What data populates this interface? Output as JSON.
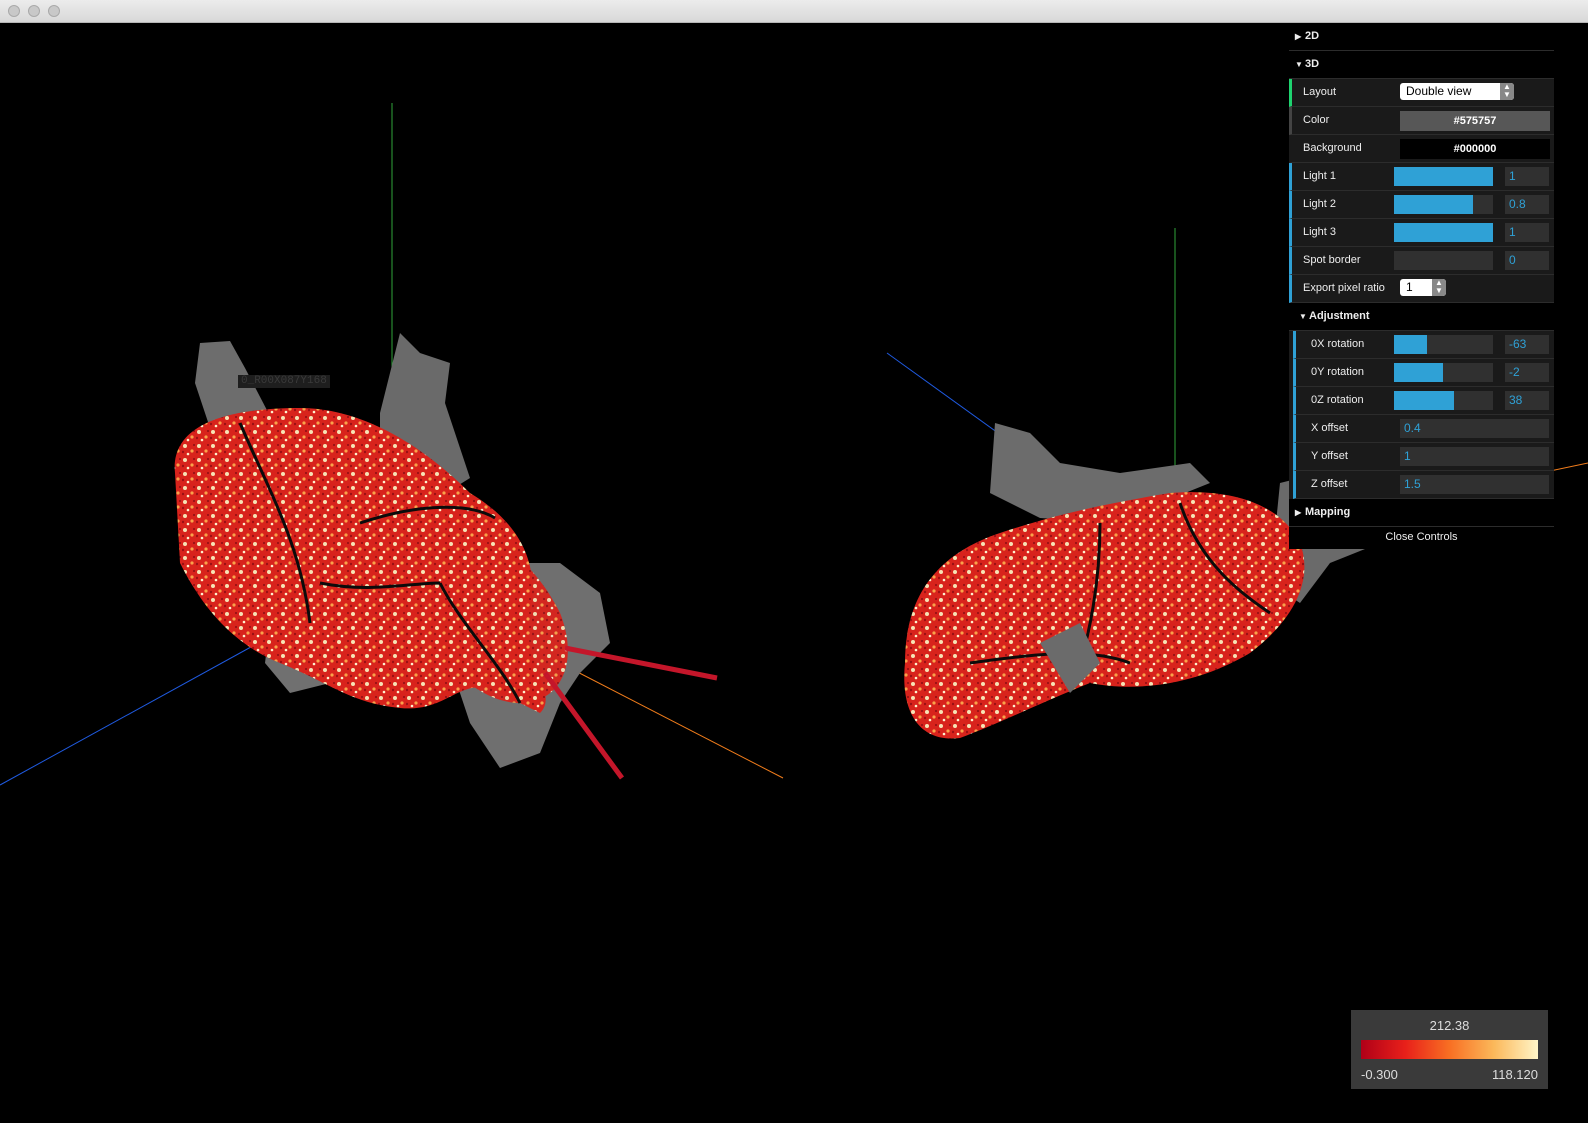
{
  "window": {
    "buttons": [
      "close",
      "minimize",
      "zoom"
    ]
  },
  "viewport": {
    "layout": "Double view",
    "mesh_label": "0_R00X087Y168",
    "axis_colors": {
      "x": "#f07c1b",
      "y": "#2fa33a",
      "z": "#1f5ae0"
    },
    "surface_color": "#575757"
  },
  "controls": {
    "folders": {
      "folder_2d": "2D",
      "folder_3d": "3D",
      "adjustment": "Adjustment",
      "mapping": "Mapping"
    },
    "layout": {
      "label": "Layout",
      "value": "Double view"
    },
    "color": {
      "label": "Color",
      "value": "#575757"
    },
    "background": {
      "label": "Background",
      "value": "#000000"
    },
    "light1": {
      "label": "Light 1",
      "value": "1",
      "fraction": 1.0
    },
    "light2": {
      "label": "Light 2",
      "value": "0.8",
      "fraction": 0.8
    },
    "light3": {
      "label": "Light 3",
      "value": "1",
      "fraction": 1.0
    },
    "spot_border": {
      "label": "Spot border",
      "value": "0",
      "fraction": 0
    },
    "export_pixel_ratio": {
      "label": "Export pixel ratio",
      "value": "1"
    },
    "rot_x": {
      "label": "0X rotation",
      "value": "-63",
      "fraction": 0.33
    },
    "rot_y": {
      "label": "0Y rotation",
      "value": "-2",
      "fraction": 0.49
    },
    "rot_z": {
      "label": "0Z rotation",
      "value": "38",
      "fraction": 0.61
    },
    "x_offset": {
      "label": "X offset",
      "value": "0.4"
    },
    "y_offset": {
      "label": "Y offset",
      "value": "1"
    },
    "z_offset": {
      "label": "Z offset",
      "value": "1.5"
    },
    "close": "Close Controls"
  },
  "colorbar": {
    "max_label": "212.38",
    "min_label": "-0.300",
    "mid_label": "118.120",
    "colors": [
      "#b00018",
      "#e8201a",
      "#f86f23",
      "#fbb85a",
      "#fff5c8"
    ]
  }
}
